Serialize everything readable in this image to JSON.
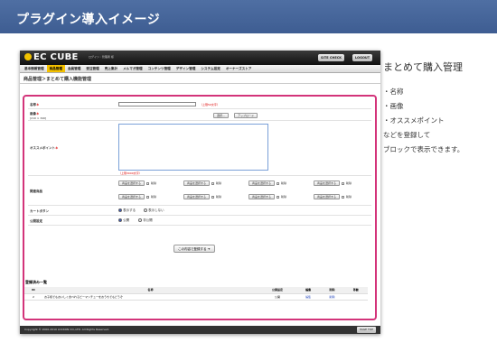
{
  "header": {
    "title": "プラグイン導入イメージ"
  },
  "app": {
    "logo": "EC CUBE",
    "login_text": "ログイン : 管理者 様",
    "site_check": "SITE CHECK",
    "logout": "LOGOUT",
    "menu": [
      "基本情報管理",
      "商品管理",
      "会員管理",
      "受注管理",
      "売上集計",
      "メルマガ管理",
      "コンテンツ管理",
      "デザイン管理",
      "システム設定",
      "オーナーズストア"
    ],
    "active_menu": "商品管理",
    "breadcrumb": "商品管理＞まとめて購入機能管理"
  },
  "form": {
    "name_label": "名称",
    "name_note": "（上限50文字）",
    "image_label": "画像",
    "image_size": "[210 × 340]",
    "browse_button": "選択...",
    "upload_button": "アップロード",
    "recommend_label": "オススメポイント",
    "recommend_note": "（上限3000文字）",
    "related_label": "関連商品",
    "select_product": "商品を選択する",
    "delete": "削除",
    "cart_label": "カートボタン",
    "cart_show": "表示する",
    "cart_hide": "表示しない",
    "publish_label": "公開設定",
    "publish_on": "公開",
    "publish_off": "非公開",
    "save_button": "この内容で登録する"
  },
  "list": {
    "title": "登録済み一覧",
    "columns": [
      "ID",
      "名称",
      "公開設定",
      "編集",
      "削除",
      "移動"
    ],
    "rows": [
      {
        "id": "2",
        "name": "お子様でもおいしく食べれるピーマンチューをおうちでもどうぞ",
        "status": "公開",
        "edit": "編集",
        "delete": "削除",
        "move": ""
      }
    ]
  },
  "footer": {
    "copyright": "Copyright © 2000-2010 LOCKON CO.,LTD. All Rights Reserved.",
    "page_top": "PAGE TOP"
  },
  "side": {
    "title": "まとめて購入管理",
    "items": [
      "・名称",
      "・画像",
      "・オススメポイント"
    ],
    "line1": "などを登録して",
    "line2": "ブロックで表示できます。"
  }
}
